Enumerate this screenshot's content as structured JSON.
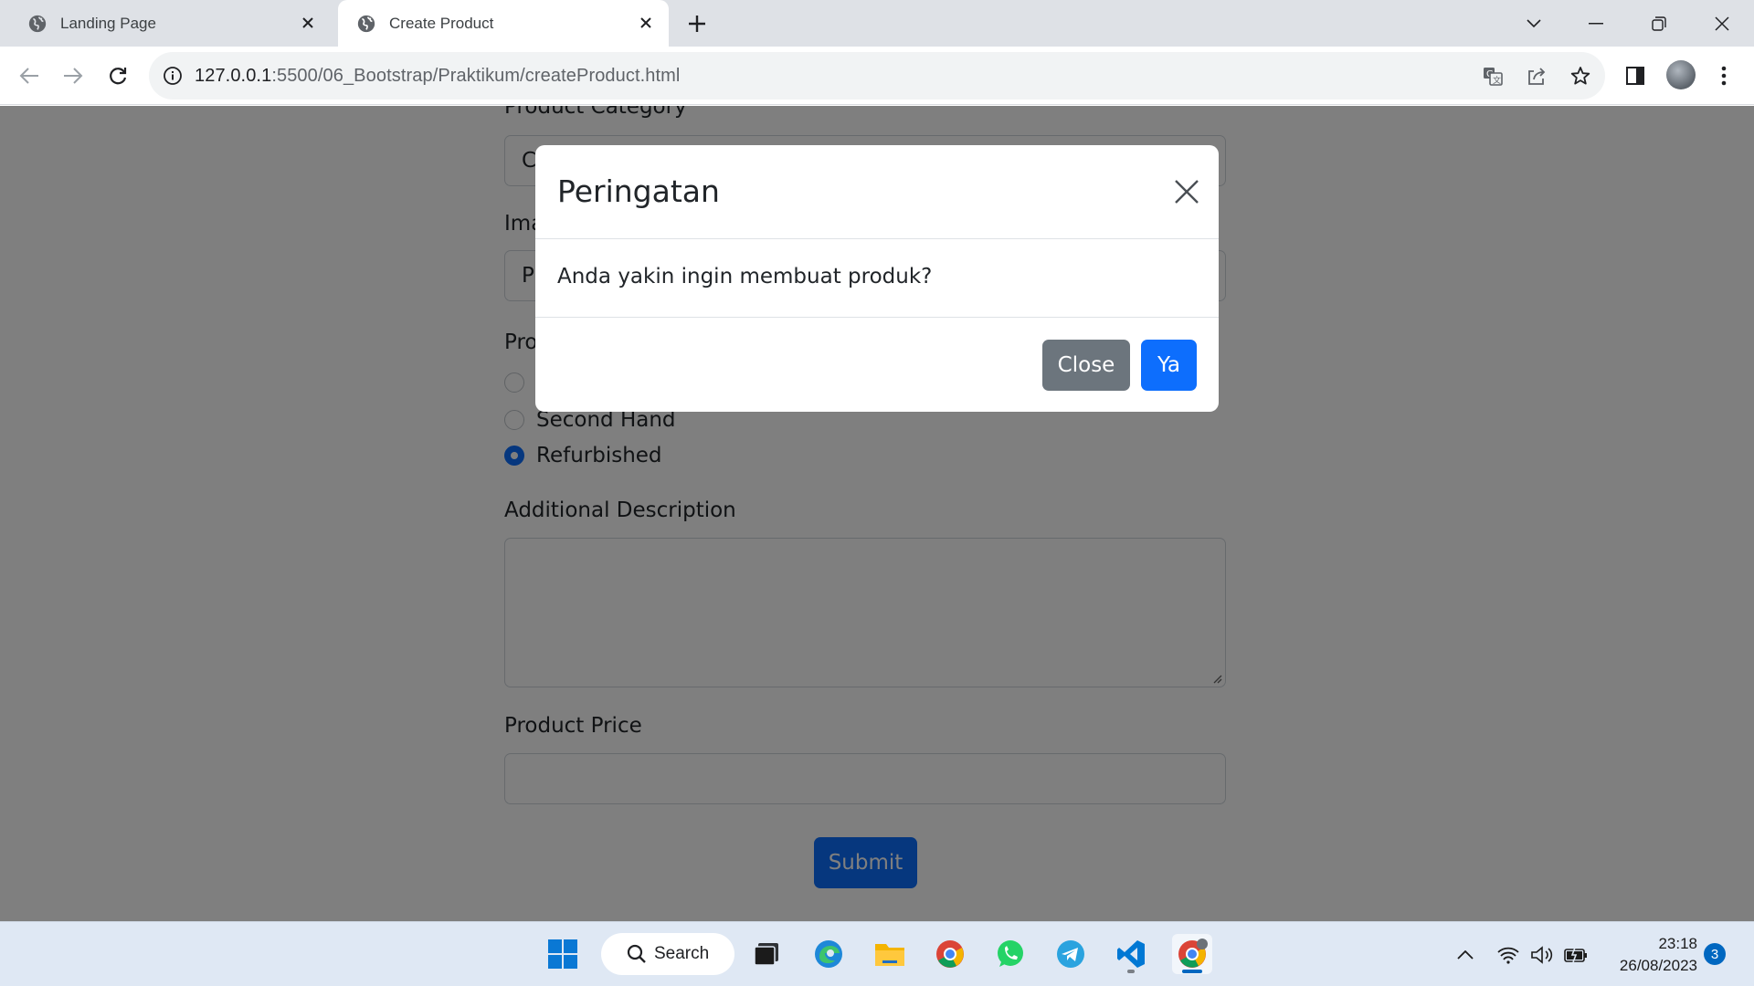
{
  "browser": {
    "tabs": [
      {
        "title": "Landing Page",
        "active": false
      },
      {
        "title": "Create Product",
        "active": true
      }
    ],
    "url_host": "127.0.0.1",
    "url_path": ":5500/06_Bootstrap/Praktikum/createProduct.html"
  },
  "form": {
    "category_label": "Product Category",
    "category_value": "C",
    "image_label": "Ima",
    "image_value": "P",
    "condition_label": "Pro",
    "conditions": [
      {
        "label": "",
        "checked": false
      },
      {
        "label": "Second Hand",
        "checked": false
      },
      {
        "label": "Refurbished",
        "checked": true
      }
    ],
    "description_label": "Additional Description",
    "price_label": "Product Price",
    "submit_label": "Submit"
  },
  "modal": {
    "title": "Peringatan",
    "body": "Anda yakin ingin membuat produk?",
    "close_label": "Close",
    "confirm_label": "Ya"
  },
  "taskbar": {
    "search_label": "Search",
    "apps": [
      "start-icon",
      "task-view-icon",
      "edge-icon",
      "file-explorer-icon",
      "chrome-icon",
      "whatsapp-icon",
      "telegram-icon",
      "vscode-icon",
      "chrome-profile-icon"
    ],
    "time": "23:18",
    "date": "26/08/2023",
    "notifications": "3"
  },
  "colors": {
    "primary": "#0d6efd",
    "secondary": "#6c757d",
    "tabstrip": "#dee1e6",
    "taskbar": "#dfe8f4"
  }
}
